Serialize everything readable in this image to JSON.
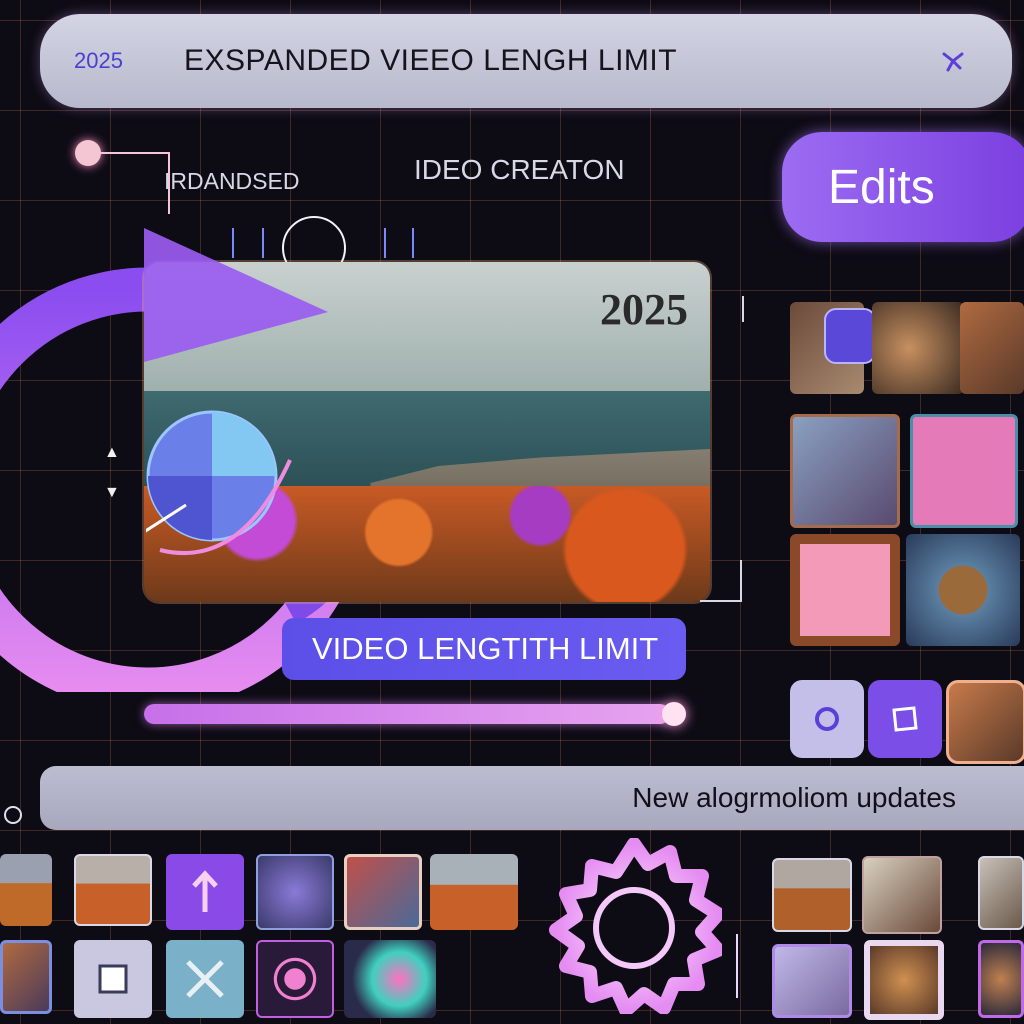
{
  "header": {
    "year": "2025",
    "title": "EXSPANDED VIEEO LENGH LIMIT"
  },
  "labels": {
    "left": "IRDANDSED",
    "center": "IDEO CREATON"
  },
  "edits_button": {
    "label": "Edits"
  },
  "video": {
    "year_overlay": "2025"
  },
  "limit_pill": {
    "label": "VIDEO LENGTITH LIMIT"
  },
  "update_bar": {
    "label": "New alogrmoliom updates"
  },
  "colors": {
    "accent_purple": "#7b3fe0",
    "pill_blue": "#5b4fe8",
    "progress_pink": "#e6a3ef"
  },
  "icons": {
    "close": "close-x-icon",
    "play": "play-icon",
    "gear": "gear-icon"
  }
}
